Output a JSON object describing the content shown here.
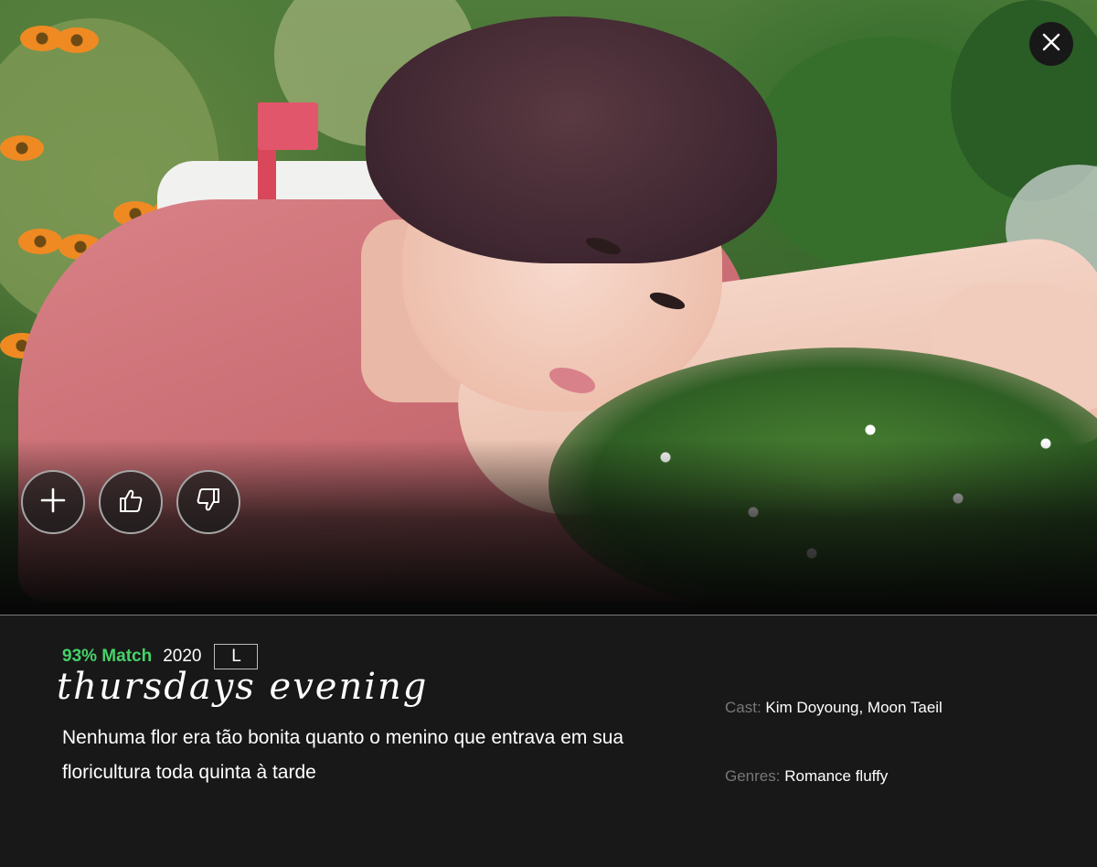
{
  "modal": {
    "close_icon": "close-icon",
    "actions": [
      {
        "name": "add-to-list",
        "icon": "plus-icon"
      },
      {
        "name": "like",
        "icon": "thumbs-up-icon"
      },
      {
        "name": "dislike",
        "icon": "thumbs-down-icon"
      }
    ]
  },
  "info": {
    "match": "93% Match",
    "year": "2020",
    "rating": "L",
    "title": "thursdays evening",
    "synopsis": "Nenhuma flor era tão bonita quanto o menino que entrava em sua floricultura toda quinta à tarde",
    "cast_label": "Cast:",
    "cast_value": "Kim Doyoung, Moon Taeil",
    "genres_label": "Genres:",
    "genres_value": "Romance fluffy"
  },
  "colors": {
    "background": "#181818",
    "match_green": "#46d369",
    "label_gray": "#777777",
    "text_white": "#ffffff"
  }
}
